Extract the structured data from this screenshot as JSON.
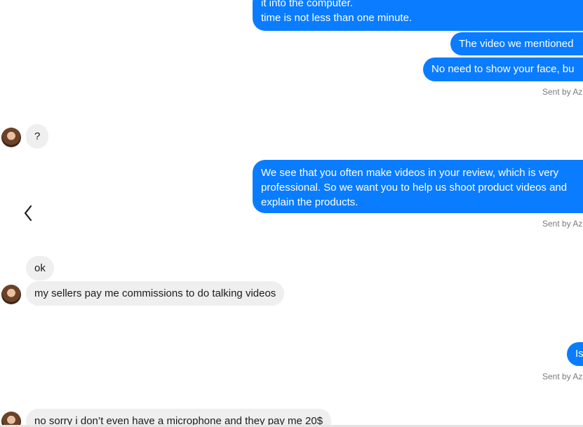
{
  "messages": [
    {
      "dir": "out",
      "text": "it into the computer.\ntime is not less than one minute."
    },
    {
      "dir": "out",
      "text": "The video we mentioned"
    },
    {
      "dir": "out",
      "text": "No need to show your face, bu"
    },
    {
      "dir": "meta",
      "text": "Sent by Az"
    },
    {
      "dir": "in",
      "text": "?"
    },
    {
      "dir": "out",
      "text": "We see that you often make videos in your review, which is very\nprofessional. So we want you to help us shoot product videos and\nexplain the products."
    },
    {
      "dir": "meta",
      "text": "Sent by Az"
    },
    {
      "dir": "in",
      "text": "ok"
    },
    {
      "dir": "in",
      "text": "my sellers pay me commissions to do talking videos"
    },
    {
      "dir": "out",
      "text": "Is"
    },
    {
      "dir": "meta",
      "text": "Sent by Az"
    },
    {
      "dir": "in",
      "text": "no sorry i don’t even have a microphone and they pay me 20$"
    }
  ],
  "icons": {
    "back": "chevron-left-icon",
    "avatar": "avatar"
  },
  "colors": {
    "outgoing_bubble": "#0a7cff",
    "incoming_bubble": "#efefef",
    "meta_text": "#7a7a7a"
  }
}
